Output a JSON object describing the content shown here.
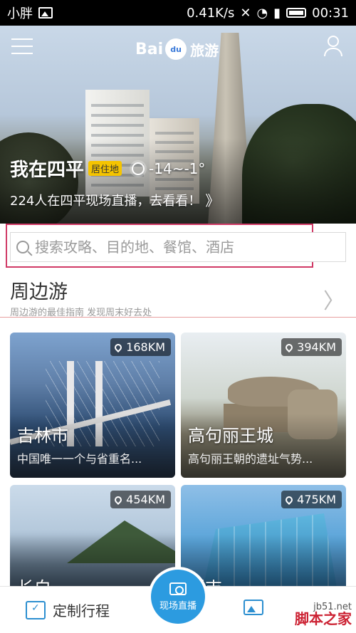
{
  "status_bar": {
    "carrier": "小胖",
    "speed": "0.41K/s",
    "time": "00:31"
  },
  "header": {
    "logo_text_latin": "Bai",
    "logo_text_paw": "du",
    "logo_text_cn": "旅游"
  },
  "hero": {
    "city": "我在四平",
    "city_badge": "居住地",
    "temperature": "-14~-1°",
    "live_prompt": "224人在四平现场直播，去看看！",
    "live_chevron": "》"
  },
  "search": {
    "placeholder": "搜索攻略、目的地、餐馆、酒店"
  },
  "section": {
    "title": "周边游",
    "subtitle": "周边游的最佳指南 发现周末好去处",
    "chevron": "〉"
  },
  "cards": [
    {
      "distance": "168KM",
      "title": "吉林市",
      "desc": "中国唯一一个与省重名..."
    },
    {
      "distance": "394KM",
      "title": "高句丽王城",
      "desc": "高句丽王朝的遗址气势..."
    },
    {
      "distance": "454KM",
      "title": "长白",
      "desc": ""
    },
    {
      "distance": "475KM",
      "title": "延吉",
      "desc": ""
    }
  ],
  "bottom_nav": {
    "custom_trip": "定制行程",
    "live": "现场直播"
  },
  "watermark": {
    "site": "jb51.net",
    "name": "脚本之家"
  },
  "colors": {
    "accent_blue": "#2c9be0",
    "badge_yellow": "#f5c400",
    "highlight_border": "#d03a66"
  }
}
